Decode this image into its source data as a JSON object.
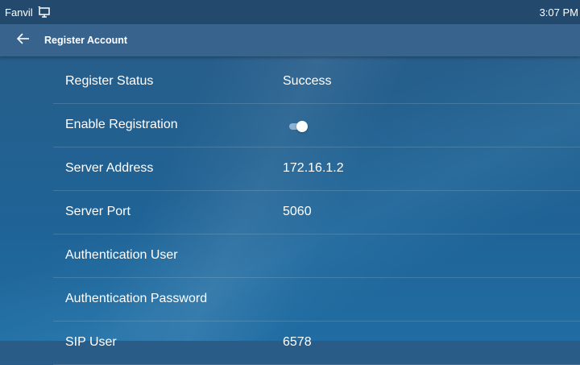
{
  "status_bar": {
    "brand": "Fanvil",
    "time": "3:07 PM",
    "icon": "desktop-monitor-icon"
  },
  "app_bar": {
    "back_icon": "arrow-left-icon",
    "title": "Register Account"
  },
  "settings": [
    {
      "label": "Register Status",
      "value": "Success"
    },
    {
      "label": "Enable Registration",
      "toggle": true
    },
    {
      "label": "Server Address",
      "value": "172.16.1.2"
    },
    {
      "label": "Server Port",
      "value": "5060"
    },
    {
      "label": "Authentication User",
      "value": ""
    },
    {
      "label": "Authentication Password",
      "value": ""
    },
    {
      "label": "SIP User",
      "value": "6578"
    }
  ],
  "colors": {
    "toggle_on": "#ffffff",
    "status_bar_bg": "#23496d",
    "app_bar_bg": "#3a648c"
  }
}
